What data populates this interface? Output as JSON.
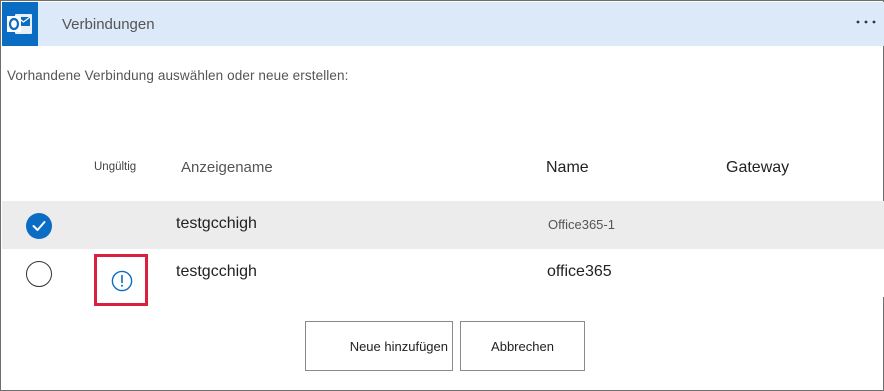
{
  "header": {
    "title": "Verbindungen",
    "app_icon": "outlook-icon",
    "more_icon": "ellipsis-icon"
  },
  "subtitle": "Vorhandene Verbindung auswählen oder neue erstellen:",
  "table": {
    "columns": {
      "invalid": "Ungültig",
      "display_name": "Anzeigename",
      "name": "Name",
      "gateway": "Gateway"
    },
    "rows": [
      {
        "selected": true,
        "invalid": false,
        "display_name": "testgcchigh",
        "name": "Office365-1",
        "gateway": ""
      },
      {
        "selected": false,
        "invalid": true,
        "display_name": "testgcchigh",
        "name": "office365",
        "gateway": ""
      }
    ]
  },
  "buttons": {
    "add": "Neue hinzufügen",
    "cancel": "Abbrechen"
  },
  "colors": {
    "header_bg": "#dbe9f8",
    "accent": "#0a6cc2",
    "highlight_border": "#d9213f",
    "selected_row_bg": "#ececec"
  }
}
